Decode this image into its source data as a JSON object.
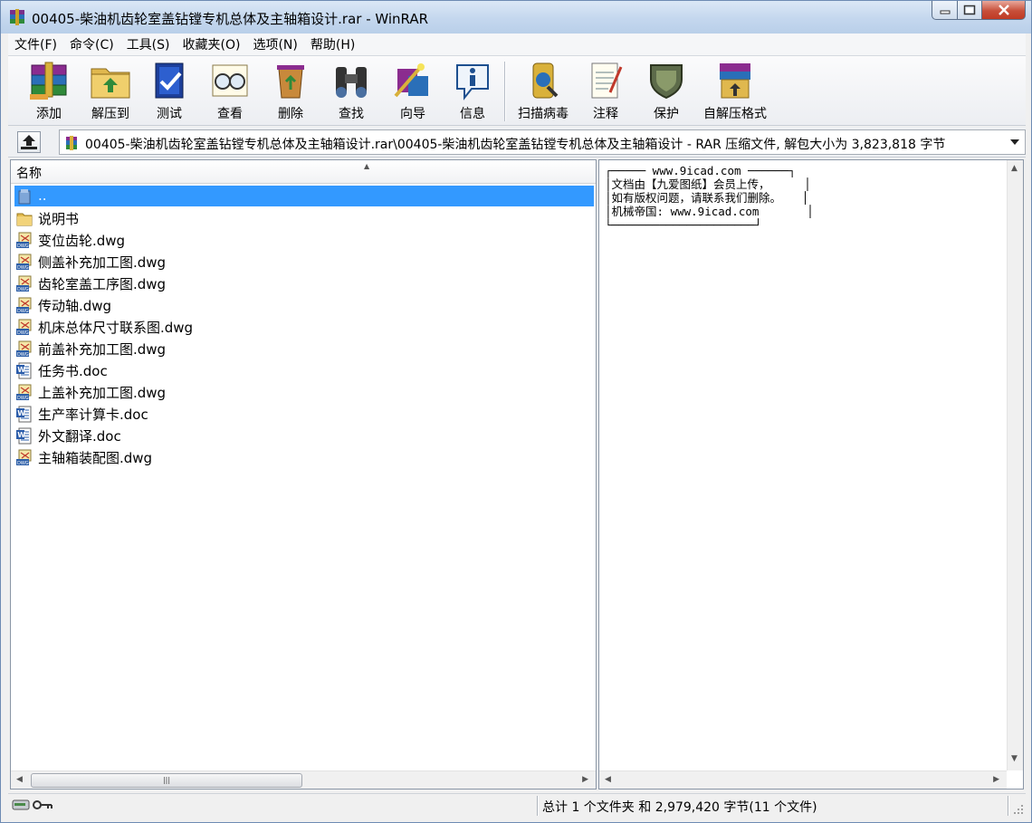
{
  "window": {
    "title": "00405-柴油机齿轮室盖钻镗专机总体及主轴箱设计.rar - WinRAR"
  },
  "menu": [
    {
      "id": "file",
      "label": "文件(F)"
    },
    {
      "id": "commands",
      "label": "命令(C)"
    },
    {
      "id": "tools",
      "label": "工具(S)"
    },
    {
      "id": "favorites",
      "label": "收藏夹(O)"
    },
    {
      "id": "options",
      "label": "选项(N)"
    },
    {
      "id": "help",
      "label": "帮助(H)"
    }
  ],
  "toolbar": [
    {
      "id": "add",
      "label": "添加",
      "icon": "books-icon"
    },
    {
      "id": "extract",
      "label": "解压到",
      "icon": "folder-extract-icon"
    },
    {
      "id": "test",
      "label": "测试",
      "icon": "checkmark-book-icon"
    },
    {
      "id": "view",
      "label": "查看",
      "icon": "glasses-icon"
    },
    {
      "id": "delete",
      "label": "删除",
      "icon": "recycle-bin-icon"
    },
    {
      "id": "find",
      "label": "查找",
      "icon": "binoculars-icon"
    },
    {
      "id": "wizard",
      "label": "向导",
      "icon": "wand-icon"
    },
    {
      "id": "info",
      "label": "信息",
      "icon": "info-icon"
    },
    {
      "id": "scan",
      "label": "扫描病毒",
      "icon": "virus-scan-icon"
    },
    {
      "id": "comment",
      "label": "注释",
      "icon": "notepad-icon"
    },
    {
      "id": "protect",
      "label": "保护",
      "icon": "shield-icon"
    },
    {
      "id": "sfx",
      "label": "自解压格式",
      "icon": "sfx-box-icon"
    }
  ],
  "address": {
    "path": "00405-柴油机齿轮室盖钻镗专机总体及主轴箱设计.rar\\00405-柴油机齿轮室盖钻镗专机总体及主轴箱设计 - RAR 压缩文件, 解包大小为 3,823,818 字节"
  },
  "list": {
    "column_name": "名称",
    "items": [
      {
        "name": "..",
        "type": "parent",
        "selected": true
      },
      {
        "name": "说明书",
        "type": "folder"
      },
      {
        "name": "变位齿轮.dwg",
        "type": "dwg"
      },
      {
        "name": "侧盖补充加工图.dwg",
        "type": "dwg"
      },
      {
        "name": "齿轮室盖工序图.dwg",
        "type": "dwg"
      },
      {
        "name": "传动轴.dwg",
        "type": "dwg"
      },
      {
        "name": "机床总体尺寸联系图.dwg",
        "type": "dwg"
      },
      {
        "name": "前盖补充加工图.dwg",
        "type": "dwg"
      },
      {
        "name": "任务书.doc",
        "type": "doc"
      },
      {
        "name": "上盖补充加工图.dwg",
        "type": "dwg"
      },
      {
        "name": "生产率计算卡.doc",
        "type": "doc"
      },
      {
        "name": "外文翻译.doc",
        "type": "doc"
      },
      {
        "name": "主轴箱装配图.dwg",
        "type": "dwg"
      }
    ]
  },
  "comment": {
    "text": "┌───── www.9icad.com ──────┐\n│文档由【九爱图纸】会员上传，     │\n│如有版权问题，请联系我们删除。   │\n│机械帝国: www.9icad.com       │\n└─────────────────────┘"
  },
  "status": {
    "summary": "总计 1 个文件夹 和 2,979,420 字节(11 个文件)"
  },
  "colors": {
    "selection": "#3399ff",
    "close_button": "#c74f3a"
  }
}
